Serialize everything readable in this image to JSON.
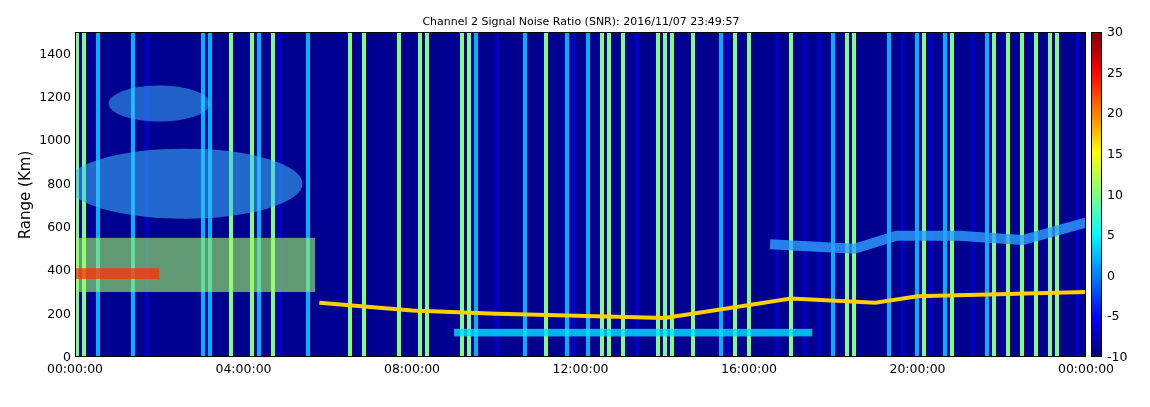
{
  "chart": {
    "title": "Channel 2 Signal Noise Ratio (SNR): 2016/11/07 23:49:57",
    "ylabel": "Range (Km)",
    "yticks": [
      "1400",
      "1200",
      "1000",
      "800",
      "600",
      "400",
      "200",
      "0"
    ],
    "xticks": [
      "00:00:00",
      "04:00:00",
      "08:00:00",
      "12:00:00",
      "16:00:00",
      "20:00:00",
      "00:00:00"
    ],
    "colorbar_ticks": [
      "30",
      "25",
      "20",
      "15",
      "10",
      "5",
      "0",
      "-5",
      "-10"
    ]
  }
}
